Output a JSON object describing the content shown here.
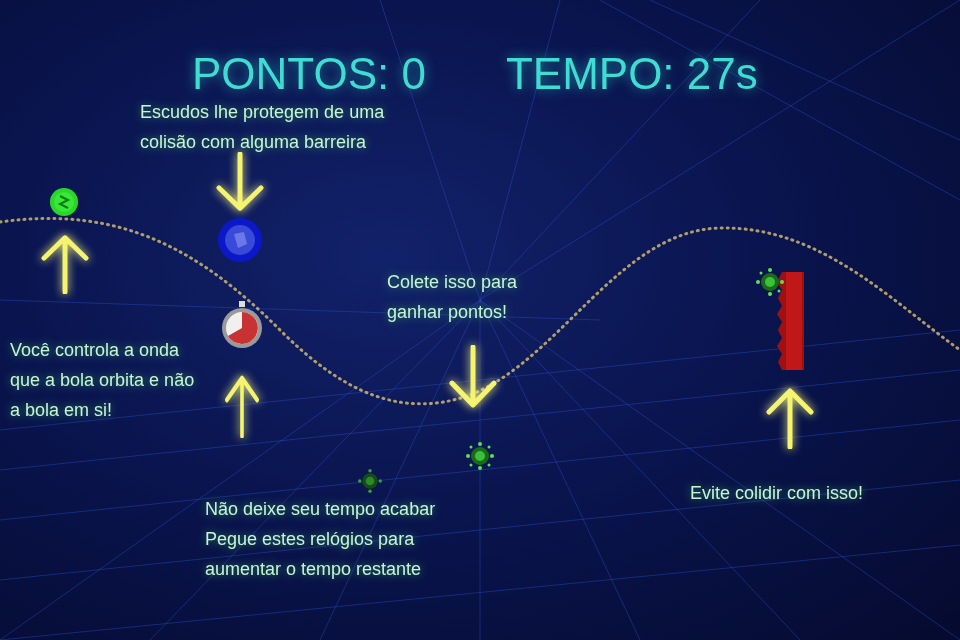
{
  "hud": {
    "score": "PONTOS: 0",
    "time": "TEMPO: 27s"
  },
  "hints": [
    {
      "lines": [
        "Escudos lhe protegem de uma",
        "colisão com alguma barreira"
      ],
      "arrow": "down"
    },
    {
      "lines": [
        "Você controla a onda",
        "que a bola orbita e não",
        "a bola em si!"
      ],
      "arrow": "up"
    },
    {
      "lines": [
        "Colete isso para",
        "ganhar pontos!"
      ],
      "arrow": "down"
    },
    {
      "lines": [
        "Não deixe seu tempo acabar",
        "Pegue estes relógios para",
        "aumentar o tempo restante"
      ],
      "arrow": "up"
    },
    {
      "lines": [
        "Evite colidir com isso!"
      ],
      "arrow": "up"
    }
  ]
}
